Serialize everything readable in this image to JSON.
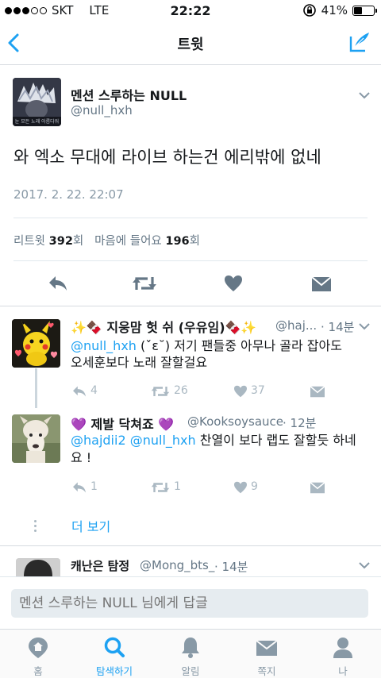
{
  "status": {
    "carrier": "SKT",
    "network": "LTE",
    "time": "22:22",
    "battery": "41%",
    "battery_level": 0.41
  },
  "nav": {
    "title": "트윗"
  },
  "tweet": {
    "display_name": "멘션 스루하는 NULL",
    "handle": "@null_hxh",
    "avatar_caption": "눈 모든 노래 아름다워",
    "text": "와 엑소 무대에 라이브 하는건 에리밖에 없네",
    "date": "2017. 2. 22. 22:07",
    "retweet_label": "리트윗",
    "retweet_count": "392",
    "count_suffix": "회",
    "like_label": "마음에 들어요",
    "like_count": "196"
  },
  "replies": [
    {
      "display_name": "✨🍫 지웅맘 헛 쉬 (우유임)🍫✨",
      "handle": "@haj...",
      "time": "· 14분",
      "mention": "@null_hxh",
      "line1": " (ˇε˘) 저기 팬들중 아무나 골라 잡아도",
      "line2": "오세훈보다 노래 잘할걸요",
      "reply_count": "4",
      "retweet_count": "26",
      "like_count": "37"
    },
    {
      "display_name": "💜 제발 닥쳐죠 💜",
      "handle": "@Kooksoysauce",
      "time": "· 12분",
      "mention1": "@hajdii2",
      "mention2": "@null_hxh",
      "line1": " 찬열이 보다 랩도 잘할듯 하네",
      "line2": "요 !",
      "reply_count": "1",
      "retweet_count": "1",
      "like_count": "9"
    }
  ],
  "more_label": "더 보기",
  "peek": {
    "display_name": "캐난은 탐정",
    "handle": "@Mong_bts_",
    "time": "· 14분"
  },
  "reply_placeholder": "멘션 스루하는 NULL 님에게 답글",
  "tabs": [
    {
      "label": "홈",
      "icon": "home-icon"
    },
    {
      "label": "탐색하기",
      "icon": "search-icon"
    },
    {
      "label": "알림",
      "icon": "bell-icon"
    },
    {
      "label": "쪽지",
      "icon": "mail-icon"
    },
    {
      "label": "나",
      "icon": "person-icon"
    }
  ],
  "colors": {
    "accent": "#1da1f2",
    "muted": "#aab8c2",
    "action": "#657786"
  }
}
